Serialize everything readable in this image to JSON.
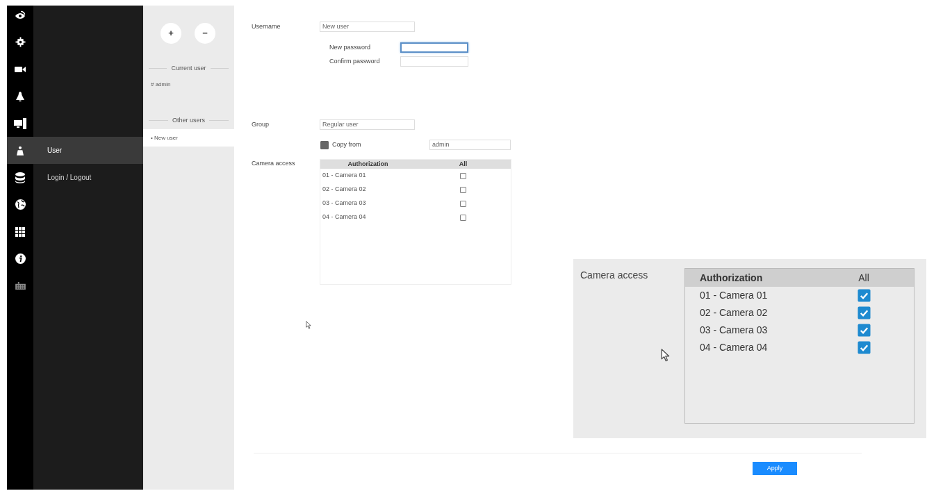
{
  "sidebar": {
    "items": [
      {
        "label": "User",
        "selected": true
      },
      {
        "label": "Login / Logout",
        "selected": false
      }
    ]
  },
  "users_panel": {
    "add_button": "+",
    "remove_button": "−",
    "current_user": {
      "heading": "Current user",
      "items": [
        {
          "label": "# admin",
          "selected": false
        }
      ]
    },
    "other_users": {
      "heading": "Other users",
      "items": [
        {
          "label": "• New user",
          "selected": true
        }
      ]
    }
  },
  "form": {
    "username": {
      "label": "Username",
      "value": "New user"
    },
    "new_password": {
      "label": "New password",
      "focused": true
    },
    "confirm_password": {
      "label": "Confirm password",
      "focused": false
    },
    "group": {
      "label": "Group",
      "value": "Regular user"
    },
    "copy_from": {
      "label": "Copy from",
      "checked": false,
      "value": "admin"
    },
    "camera_access": {
      "label": "Camera access",
      "columns": [
        "Authorization",
        "All"
      ],
      "rows": [
        {
          "name": "01 - Camera 01",
          "checked": false
        },
        {
          "name": "02 - Camera 02",
          "checked": false
        },
        {
          "name": "03 - Camera 03",
          "checked": false
        },
        {
          "name": "04 - Camera 04",
          "checked": false
        }
      ]
    }
  },
  "callout": {
    "label": "Camera access",
    "columns": [
      "Authorization",
      "All"
    ],
    "rows": [
      {
        "name": "01 - Camera 01",
        "checked": true
      },
      {
        "name": "02 - Camera 02",
        "checked": true
      },
      {
        "name": "03 - Camera 03",
        "checked": true
      },
      {
        "name": "04 - Camera 04",
        "checked": true
      }
    ]
  },
  "apply_button": "Apply"
}
